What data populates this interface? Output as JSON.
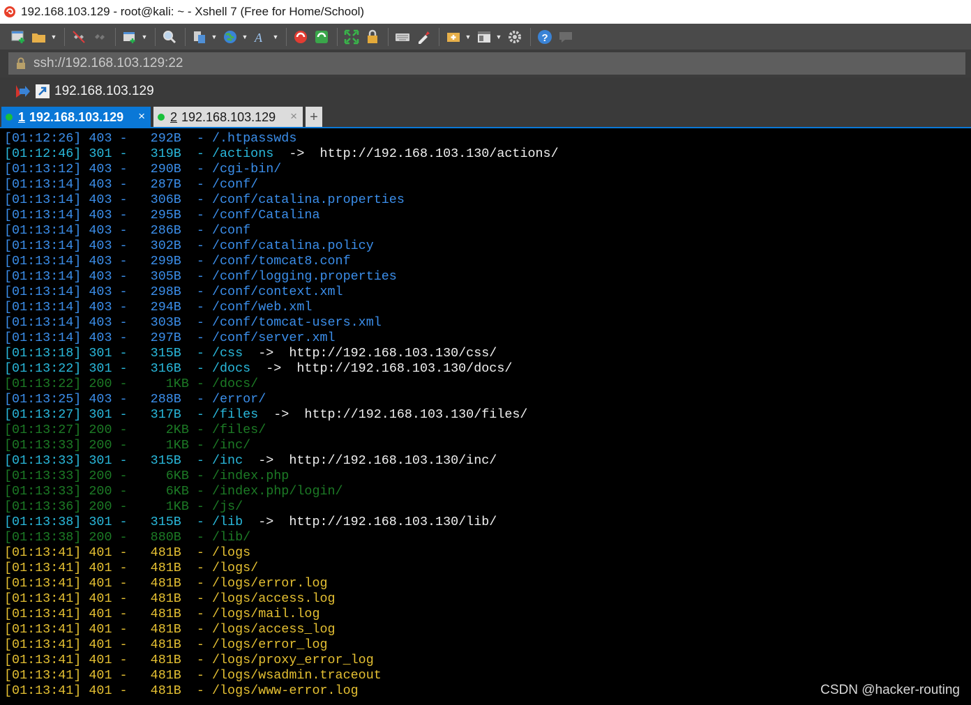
{
  "window": {
    "title": "192.168.103.129 - root@kali: ~ - Xshell 7 (Free for Home/School)"
  },
  "toolbar": {
    "icons": [
      "new-session-icon",
      "open-folder-icon",
      "disconnect-icon",
      "reconnect-icon",
      "new-tab-icon",
      "find-icon",
      "transfer-icon",
      "globe-icon",
      "font-icon",
      "xftp-icon",
      "xmanager-icon",
      "fullscreen-icon",
      "lock-icon",
      "keyboard-icon",
      "highlight-icon",
      "compose-icon",
      "layout-icon",
      "settings-icon",
      "help-icon",
      "chat-icon"
    ]
  },
  "address": {
    "url": "ssh://192.168.103.129:22"
  },
  "session": {
    "host": "192.168.103.129"
  },
  "tabs": [
    {
      "num": "1",
      "label": "192.168.103.129",
      "active": true
    },
    {
      "num": "2",
      "label": "192.168.103.129",
      "active": false
    }
  ],
  "tab_close": "×",
  "tab_add": "+",
  "colors": {
    "blue": "#3b8eea",
    "cyan": "#29b8db",
    "green": "#1c7a25",
    "yellow": "#e5c032",
    "accent": "#0a78d7"
  },
  "terminal": {
    "lines": [
      {
        "text": "[01:12:26] 403 -   292B  - /.htpasswds",
        "color": "blue",
        "redirect": ""
      },
      {
        "text": "[01:12:46] 301 -   319B  - /actions",
        "color": "cyan",
        "redirect": "  ->  http://192.168.103.130/actions/"
      },
      {
        "text": "[01:13:12] 403 -   290B  - /cgi-bin/",
        "color": "blue",
        "redirect": ""
      },
      {
        "text": "[01:13:14] 403 -   287B  - /conf/",
        "color": "blue",
        "redirect": ""
      },
      {
        "text": "[01:13:14] 403 -   306B  - /conf/catalina.properties",
        "color": "blue",
        "redirect": ""
      },
      {
        "text": "[01:13:14] 403 -   295B  - /conf/Catalina",
        "color": "blue",
        "redirect": ""
      },
      {
        "text": "[01:13:14] 403 -   286B  - /conf",
        "color": "blue",
        "redirect": ""
      },
      {
        "text": "[01:13:14] 403 -   302B  - /conf/catalina.policy",
        "color": "blue",
        "redirect": ""
      },
      {
        "text": "[01:13:14] 403 -   299B  - /conf/tomcat8.conf",
        "color": "blue",
        "redirect": ""
      },
      {
        "text": "[01:13:14] 403 -   305B  - /conf/logging.properties",
        "color": "blue",
        "redirect": ""
      },
      {
        "text": "[01:13:14] 403 -   298B  - /conf/context.xml",
        "color": "blue",
        "redirect": ""
      },
      {
        "text": "[01:13:14] 403 -   294B  - /conf/web.xml",
        "color": "blue",
        "redirect": ""
      },
      {
        "text": "[01:13:14] 403 -   303B  - /conf/tomcat-users.xml",
        "color": "blue",
        "redirect": ""
      },
      {
        "text": "[01:13:14] 403 -   297B  - /conf/server.xml",
        "color": "blue",
        "redirect": ""
      },
      {
        "text": "[01:13:18] 301 -   315B  - /css",
        "color": "cyan",
        "redirect": "  ->  http://192.168.103.130/css/"
      },
      {
        "text": "[01:13:22] 301 -   316B  - /docs",
        "color": "cyan",
        "redirect": "  ->  http://192.168.103.130/docs/"
      },
      {
        "text": "[01:13:22] 200 -     1KB - /docs/",
        "color": "green",
        "redirect": ""
      },
      {
        "text": "[01:13:25] 403 -   288B  - /error/",
        "color": "blue",
        "redirect": ""
      },
      {
        "text": "[01:13:27] 301 -   317B  - /files",
        "color": "cyan",
        "redirect": "  ->  http://192.168.103.130/files/"
      },
      {
        "text": "[01:13:27] 200 -     2KB - /files/",
        "color": "green",
        "redirect": ""
      },
      {
        "text": "[01:13:33] 200 -     1KB - /inc/",
        "color": "green",
        "redirect": ""
      },
      {
        "text": "[01:13:33] 301 -   315B  - /inc",
        "color": "cyan",
        "redirect": "  ->  http://192.168.103.130/inc/"
      },
      {
        "text": "[01:13:33] 200 -     6KB - /index.php",
        "color": "green",
        "redirect": ""
      },
      {
        "text": "[01:13:33] 200 -     6KB - /index.php/login/",
        "color": "green",
        "redirect": ""
      },
      {
        "text": "[01:13:36] 200 -     1KB - /js/",
        "color": "green",
        "redirect": ""
      },
      {
        "text": "[01:13:38] 301 -   315B  - /lib",
        "color": "cyan",
        "redirect": "  ->  http://192.168.103.130/lib/"
      },
      {
        "text": "[01:13:38] 200 -   880B  - /lib/",
        "color": "green",
        "redirect": ""
      },
      {
        "text": "[01:13:41] 401 -   481B  - /logs",
        "color": "yellow",
        "redirect": ""
      },
      {
        "text": "[01:13:41] 401 -   481B  - /logs/",
        "color": "yellow",
        "redirect": ""
      },
      {
        "text": "[01:13:41] 401 -   481B  - /logs/error.log",
        "color": "yellow",
        "redirect": ""
      },
      {
        "text": "[01:13:41] 401 -   481B  - /logs/access.log",
        "color": "yellow",
        "redirect": ""
      },
      {
        "text": "[01:13:41] 401 -   481B  - /logs/mail.log",
        "color": "yellow",
        "redirect": ""
      },
      {
        "text": "[01:13:41] 401 -   481B  - /logs/access_log",
        "color": "yellow",
        "redirect": ""
      },
      {
        "text": "[01:13:41] 401 -   481B  - /logs/error_log",
        "color": "yellow",
        "redirect": ""
      },
      {
        "text": "[01:13:41] 401 -   481B  - /logs/proxy_error_log",
        "color": "yellow",
        "redirect": ""
      },
      {
        "text": "[01:13:41] 401 -   481B  - /logs/wsadmin.traceout",
        "color": "yellow",
        "redirect": ""
      },
      {
        "text": "[01:13:41] 401 -   481B  - /logs/www-error.log",
        "color": "yellow",
        "redirect": ""
      }
    ]
  },
  "watermark": "CSDN @hacker-routing"
}
